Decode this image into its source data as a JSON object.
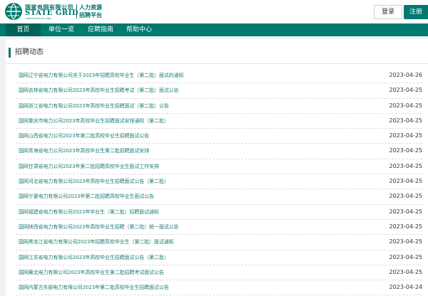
{
  "header": {
    "logo": {
      "cn": "国家电网有限公司",
      "en": "STATE GRID",
      "corp": "CORPORATION OF CHINA",
      "sub_line1": "人力资源",
      "sub_line2": "招聘平台"
    },
    "login_label": "登录",
    "register_label": "注册"
  },
  "nav": {
    "items": [
      {
        "label": "首页",
        "active": true
      },
      {
        "label": "单位一览",
        "active": false
      },
      {
        "label": "应聘指南",
        "active": false
      },
      {
        "label": "帮助中心",
        "active": false
      }
    ]
  },
  "main": {
    "section_title": "招聘动态",
    "notices": [
      {
        "title": "国网辽宁省电力有限公司关于2023年招聘高校毕业生（第二批）面试的通知",
        "date": "2023-04-26"
      },
      {
        "title": "国网吉林省电力有限公司2023年高校毕业生招聘考试（第二批）面试公告",
        "date": "2023-04-25"
      },
      {
        "title": "国网浙江省电力有限公司2023年高校毕业生招聘面试（第二批）公告",
        "date": "2023-04-25"
      },
      {
        "title": "国网重庆市电力公司2023年高校毕业生招聘面试安排通知（第二批）",
        "date": "2023-04-25"
      },
      {
        "title": "国网山西省电力公司2023年第二批高校毕业生招聘面试公告",
        "date": "2023-04-25"
      },
      {
        "title": "国网青海省电力公司2023年高校毕业生第二批招聘面试安排",
        "date": "2023-04-25"
      },
      {
        "title": "国网甘肃省电力公司2023年第二批招聘高校毕业生面试工作安排",
        "date": "2023-04-25"
      },
      {
        "title": "国网河北省电力有限公司2023年高校毕业生招聘面试公告（第二批）",
        "date": "2023-04-25"
      },
      {
        "title": "国网宁夏电力有限公司2023年第二批招聘高校毕业生面试公告",
        "date": "2023-04-25"
      },
      {
        "title": "国网福建省电力有限公司2023年毕业生（第二批）招聘面试通知",
        "date": "2023-04-25"
      },
      {
        "title": "国网陕西省电力有限公司2023年高校毕业生招聘（第二批）统一面试公告",
        "date": "2023-04-25"
      },
      {
        "title": "国网黑龙江省电力有限公司2023年招聘高校毕业生（第二批）面试通知",
        "date": "2023-04-25"
      },
      {
        "title": "国网江苏省电力有限公司2023年高校毕业生招聘面试公告（第二批）",
        "date": "2023-04-25"
      },
      {
        "title": "国网冀北电力有限公司2023年高校毕业生第二批招聘考试面试公告",
        "date": "2023-04-25"
      },
      {
        "title": "国网内蒙古东部电力有限公司2023年第二批高校毕业生招聘面试公告",
        "date": "2023-04-24"
      }
    ]
  },
  "colors": {
    "brand": "#00796f",
    "brand_dark": "#006159",
    "link": "#1c7c74"
  }
}
